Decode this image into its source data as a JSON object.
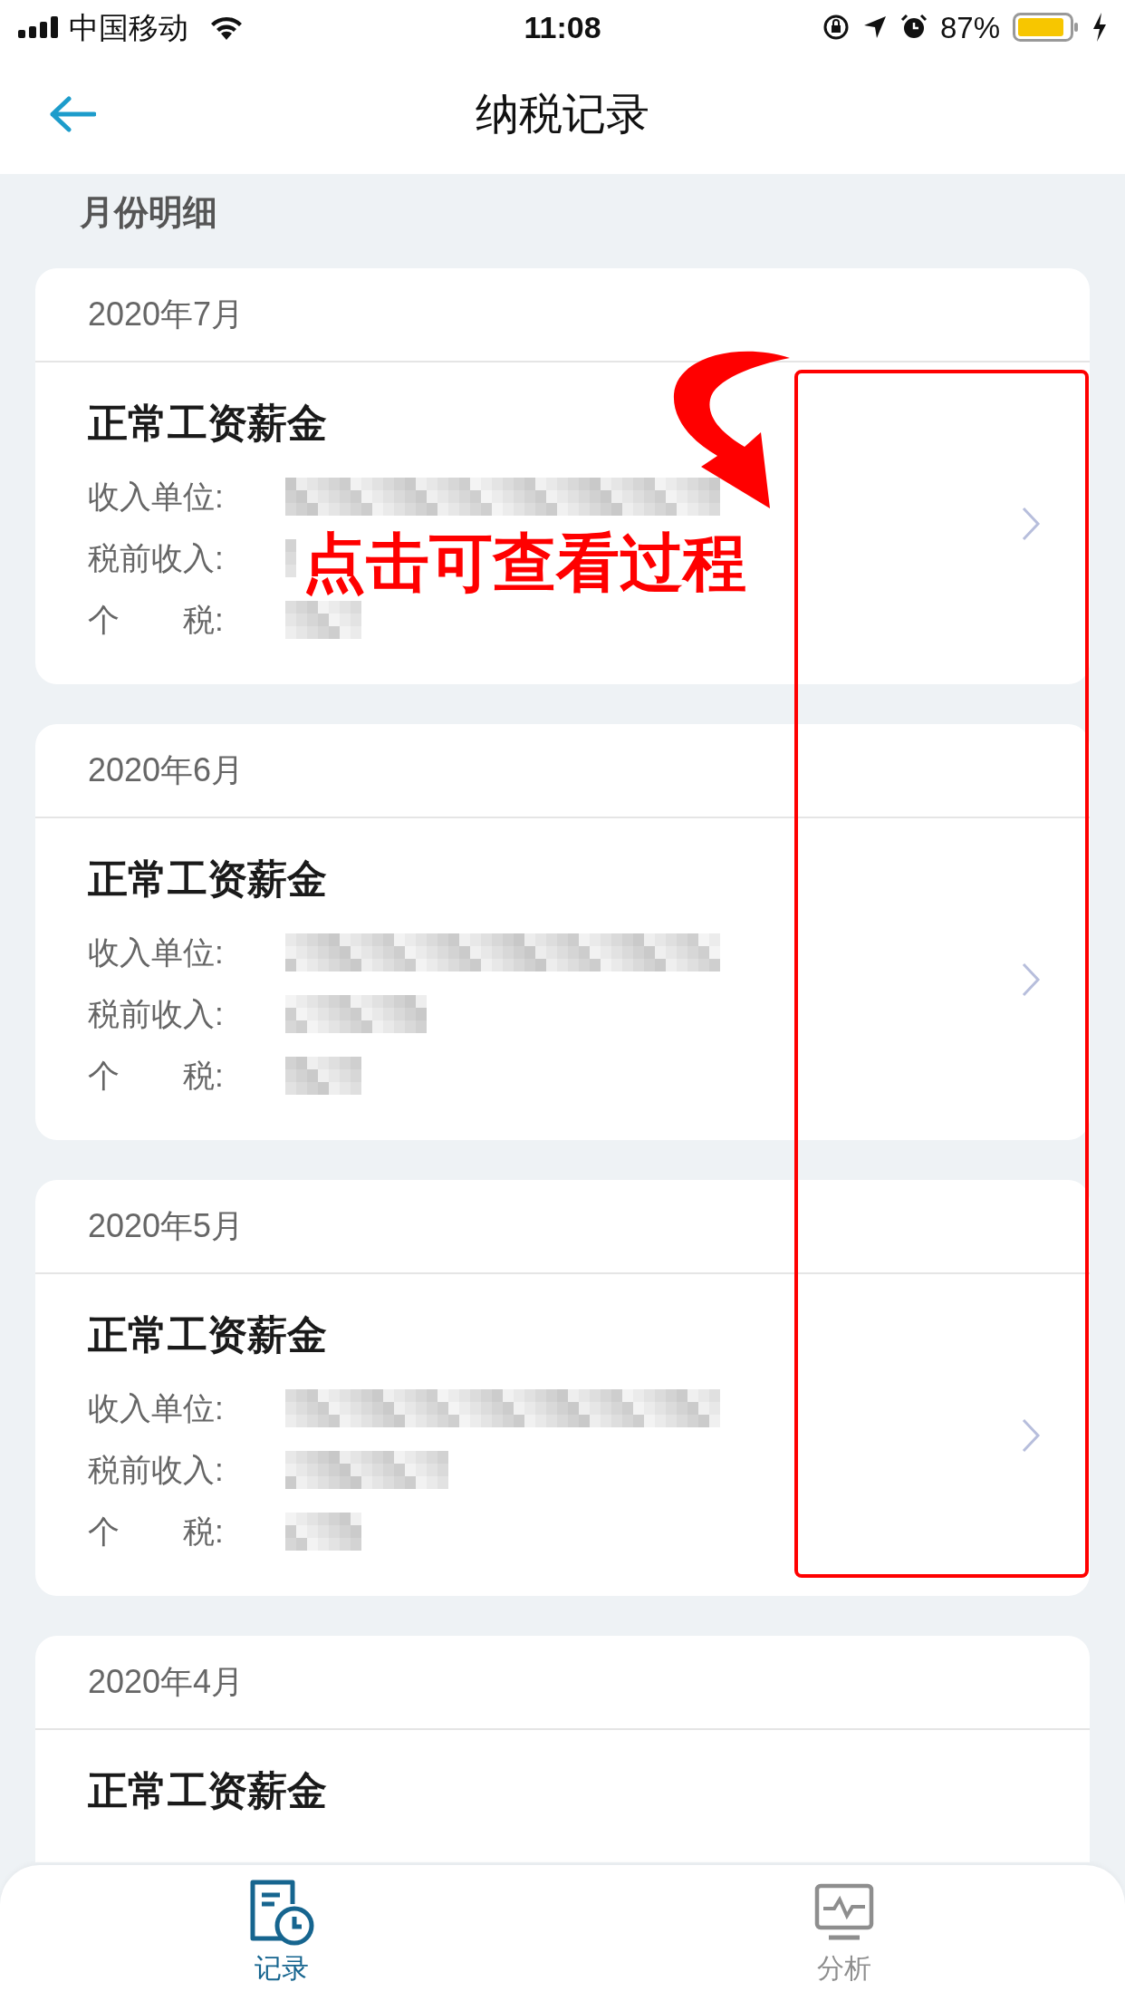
{
  "status_bar": {
    "carrier": "中国移动",
    "time": "11:08",
    "battery": "87%"
  },
  "nav": {
    "title": "纳税记录"
  },
  "section_title": "月份明细",
  "records": [
    {
      "month": "2020年7月",
      "title": "正常工资薪金",
      "fields": [
        "收入单位:",
        "税前收入:",
        "个　　税:"
      ]
    },
    {
      "month": "2020年6月",
      "title": "正常工资薪金",
      "fields": [
        "收入单位:",
        "税前收入:",
        "个　　税:"
      ]
    },
    {
      "month": "2020年5月",
      "title": "正常工资薪金",
      "fields": [
        "收入单位:",
        "税前收入:",
        "个　　税:"
      ]
    },
    {
      "month": "2020年4月",
      "title": "正常工资薪金"
    }
  ],
  "annotation": {
    "text": "点击可查看过程"
  },
  "tabs": [
    {
      "label": "记录",
      "selected": true
    },
    {
      "label": "分析",
      "selected": false
    }
  ]
}
